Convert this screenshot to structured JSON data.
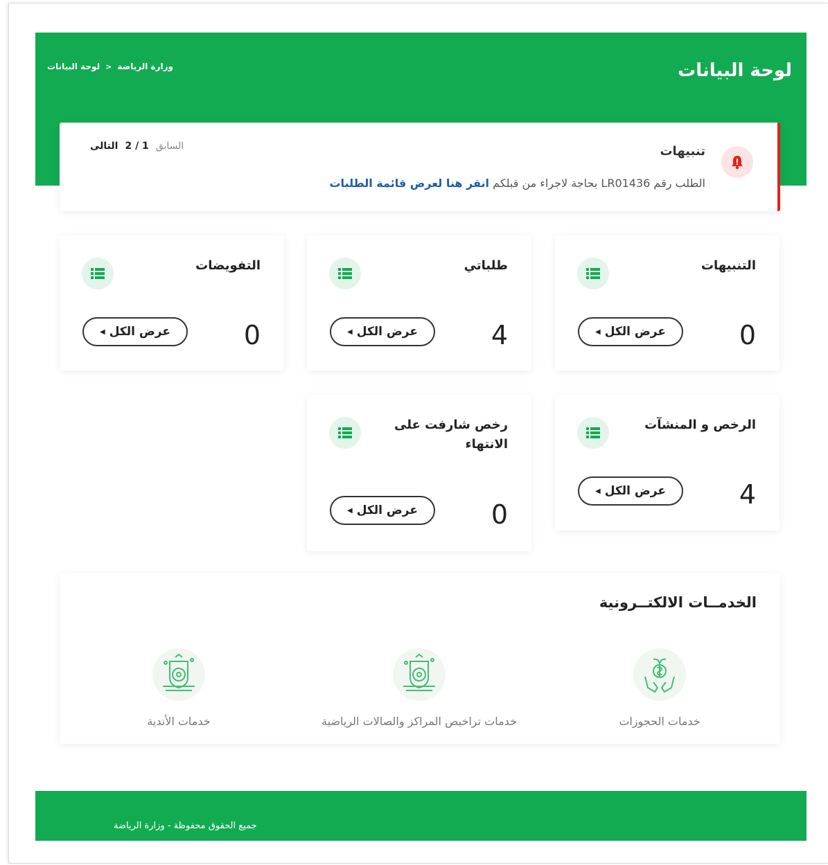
{
  "header": {
    "title": "لوحة البيانات",
    "breadcrumb": {
      "home": "وزارة الرياضة",
      "separator": ">",
      "current": "لوحة البيانات"
    },
    "color": "#13ab52"
  },
  "alert": {
    "title": "تنبيهات",
    "message_text": "الطلب رقم LR01436 بحاجة لاجراء من قبلكم",
    "link_text": "انقر هنا لعرض قائمة الطلبات",
    "pager": {
      "next": "التالى",
      "count": "2 / 1",
      "prev": "السابق"
    },
    "accent_color": "#e2231a",
    "icon": "bell-icon"
  },
  "cards": [
    {
      "title": "التنبيهات",
      "value": "0",
      "button": "عرض الكل",
      "icon": "list-icon"
    },
    {
      "title": "طلباتي",
      "value": "4",
      "button": "عرض الكل",
      "icon": "list-icon"
    },
    {
      "title": "التفويضات",
      "value": "0",
      "button": "عرض الكل",
      "icon": "list-icon"
    },
    {
      "title": "الرخص و المنشآت",
      "value": "4",
      "button": "عرض الكل",
      "icon": "list-icon"
    },
    {
      "title": "رخص شارفت على الانتهاء",
      "value": "0",
      "button": "عرض الكل",
      "icon": "list-icon"
    }
  ],
  "services": {
    "title": "الخدمــات الالكتــرونية",
    "items": [
      {
        "label": "خدمات الحجوزات",
        "icon": "money-hands-icon"
      },
      {
        "label": "خدمات تراخيص المراكز والصالات الرياضية",
        "icon": "sports-emblem-icon"
      },
      {
        "label": "خدمات الأندية",
        "icon": "club-emblem-icon"
      }
    ]
  },
  "footer": {
    "text": "جميع الحقوق محفوظة - وزارة الرياضة"
  }
}
